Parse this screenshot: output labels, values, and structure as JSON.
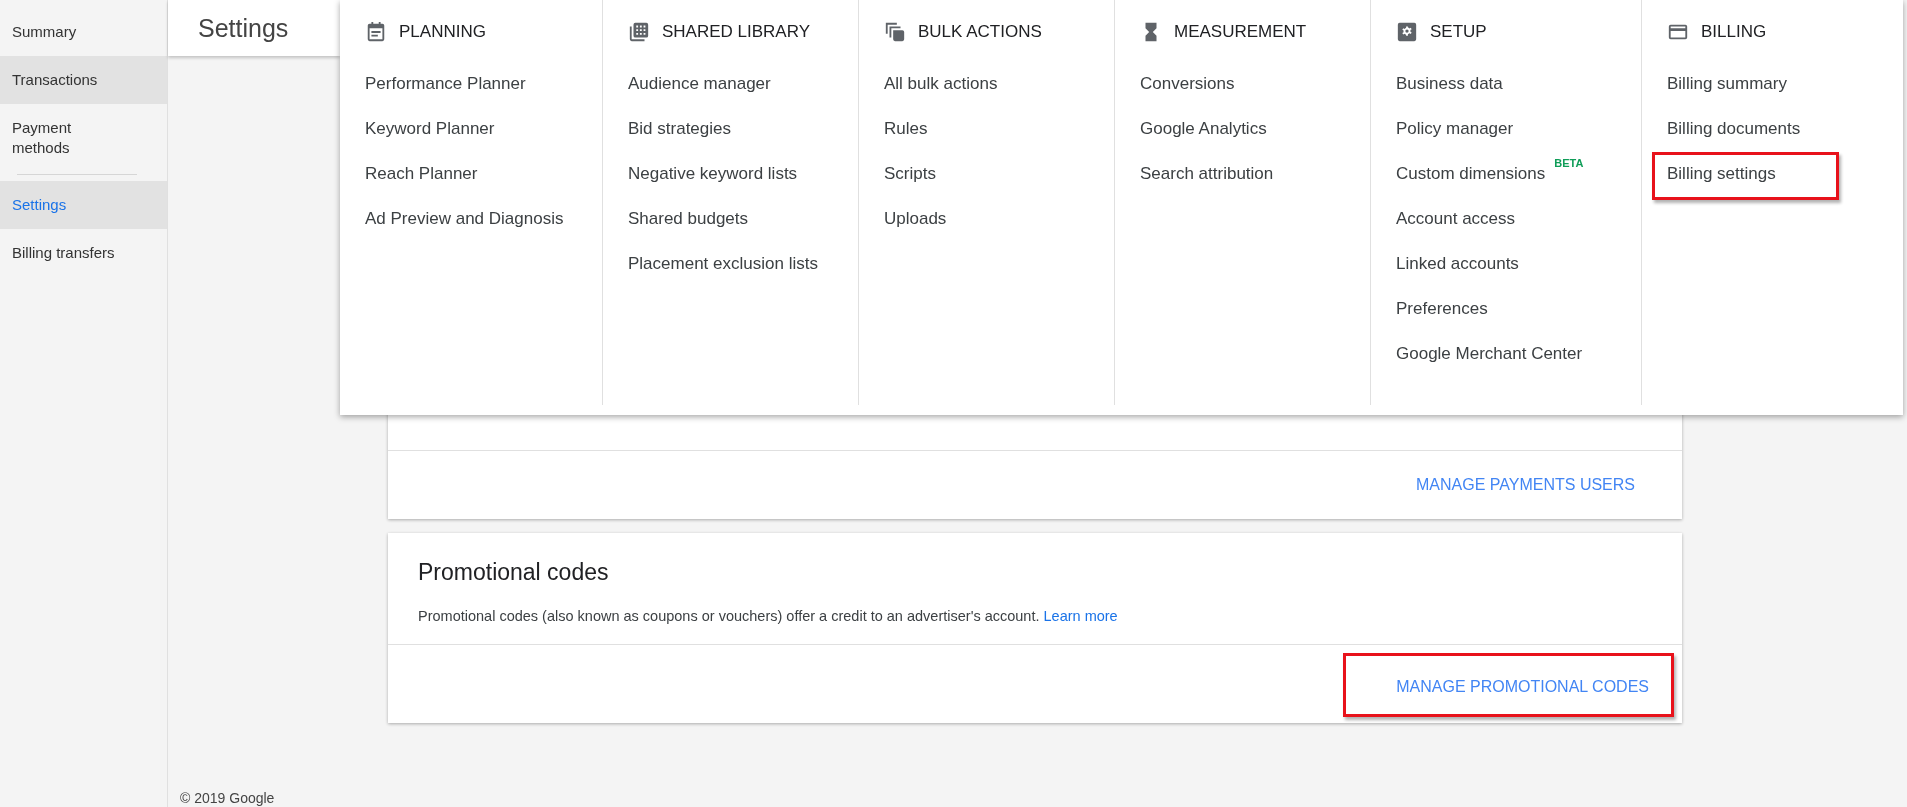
{
  "sidebar": {
    "items": [
      {
        "label": "Summary",
        "selected": false,
        "hovered": false
      },
      {
        "label": "Transactions",
        "selected": false,
        "hovered": true
      },
      {
        "label": "Payment methods",
        "selected": false,
        "hovered": false,
        "divider_after": true
      },
      {
        "label": "Settings",
        "selected": true,
        "hovered": false
      },
      {
        "label": "Billing transfers",
        "selected": false,
        "hovered": false
      }
    ]
  },
  "page_title": "Settings",
  "payments_card": {
    "action": "MANAGE PAYMENTS USERS"
  },
  "promo_card": {
    "title": "Promotional codes",
    "description": "Promotional codes (also known as coupons or vouchers) offer a credit to an advertiser's account.",
    "link": "Learn more",
    "action": "MANAGE PROMOTIONAL CODES",
    "action_highlighted": true
  },
  "footer": "© 2019 Google",
  "tools_menu": {
    "columns": [
      {
        "kind": "planning",
        "heading": "PLANNING",
        "items": [
          {
            "label": "Performance Planner",
            "highlighted": false
          },
          {
            "label": "Keyword Planner",
            "highlighted": false
          },
          {
            "label": "Reach Planner",
            "highlighted": false
          },
          {
            "label": "Ad Preview and Diagnosis",
            "highlighted": false
          }
        ]
      },
      {
        "kind": "library",
        "heading": "SHARED LIBRARY",
        "items": [
          {
            "label": "Audience manager",
            "highlighted": false
          },
          {
            "label": "Bid strategies",
            "highlighted": false
          },
          {
            "label": "Negative keyword lists",
            "highlighted": false
          },
          {
            "label": "Shared budgets",
            "highlighted": false
          },
          {
            "label": "Placement exclusion lists",
            "highlighted": false
          }
        ]
      },
      {
        "kind": "bulk",
        "heading": "BULK ACTIONS",
        "items": [
          {
            "label": "All bulk actions",
            "highlighted": false
          },
          {
            "label": "Rules",
            "highlighted": false
          },
          {
            "label": "Scripts",
            "highlighted": false
          },
          {
            "label": "Uploads",
            "highlighted": false
          }
        ]
      },
      {
        "kind": "measurement",
        "heading": "MEASUREMENT",
        "items": [
          {
            "label": "Conversions",
            "highlighted": false
          },
          {
            "label": "Google Analytics",
            "highlighted": false
          },
          {
            "label": "Search attribution",
            "highlighted": false
          }
        ]
      },
      {
        "kind": "setup",
        "heading": "SETUP",
        "items": [
          {
            "label": "Business data",
            "highlighted": false
          },
          {
            "label": "Policy manager",
            "highlighted": false
          },
          {
            "label": "Custom dimensions",
            "badge": "BETA",
            "highlighted": false
          },
          {
            "label": "Account access",
            "highlighted": false
          },
          {
            "label": "Linked accounts",
            "highlighted": false
          },
          {
            "label": "Preferences",
            "highlighted": false
          },
          {
            "label": "Google Merchant Center",
            "highlighted": false
          }
        ]
      },
      {
        "kind": "billing",
        "heading": "BILLING",
        "items": [
          {
            "label": "Billing summary",
            "highlighted": false
          },
          {
            "label": "Billing documents",
            "highlighted": false
          },
          {
            "label": "Billing settings",
            "highlighted": true
          }
        ]
      }
    ]
  }
}
